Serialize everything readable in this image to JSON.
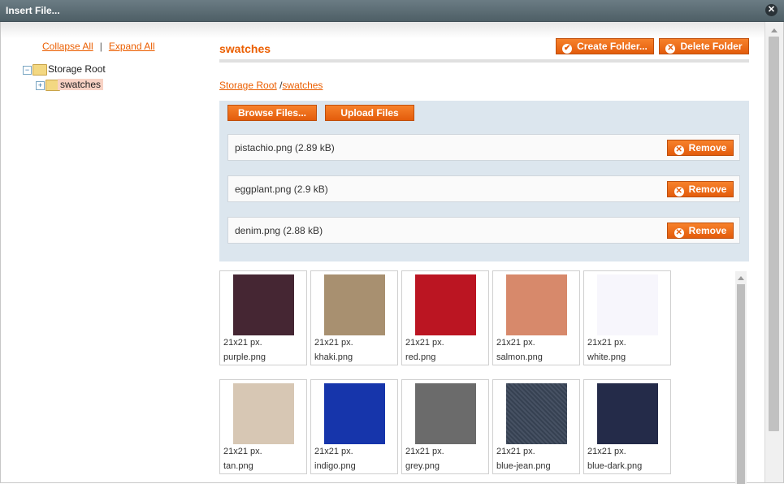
{
  "dialog": {
    "title": "Insert File...",
    "close_icon": "close-icon"
  },
  "tree": {
    "collapse_all": "Collapse All",
    "separator": "|",
    "expand_all": "Expand All",
    "root_label": "Storage Root",
    "child_label": "swatches"
  },
  "main": {
    "title": "swatches",
    "create_folder": "Create Folder...",
    "delete_folder": "Delete Folder"
  },
  "breadcrumb": {
    "root": "Storage Root",
    "sep": "/",
    "current": "swatches"
  },
  "upload": {
    "browse": "Browse Files...",
    "upload": "Upload Files",
    "remove_label": "Remove",
    "files": [
      {
        "name": "pistachio.png (2.89 kB)"
      },
      {
        "name": "eggplant.png (2.9 kB)"
      },
      {
        "name": "denim.png (2.88 kB)"
      }
    ]
  },
  "grid": {
    "items": [
      {
        "dim": "21x21 px.",
        "name": "purple.png",
        "color": "#452633"
      },
      {
        "dim": "21x21 px.",
        "name": "khaki.png",
        "color": "#a89070"
      },
      {
        "dim": "21x21 px.",
        "name": "red.png",
        "color": "#bb1522"
      },
      {
        "dim": "21x21 px.",
        "name": "salmon.png",
        "color": "#d7896b"
      },
      {
        "dim": "21x21 px.",
        "name": "white.png",
        "color": "#f7f6fc"
      },
      {
        "dim": "21x21 px.",
        "name": "tan.png",
        "color": "#d7c7b4"
      },
      {
        "dim": "21x21 px.",
        "name": "indigo.png",
        "color": "#1635ab"
      },
      {
        "dim": "21x21 px.",
        "name": "grey.png",
        "color": "#6b6b6b"
      },
      {
        "dim": "21x21 px.",
        "name": "blue-jean.png",
        "color": "#3b4659"
      },
      {
        "dim": "21x21 px.",
        "name": "blue-dark.png",
        "color": "#242b49"
      }
    ]
  }
}
